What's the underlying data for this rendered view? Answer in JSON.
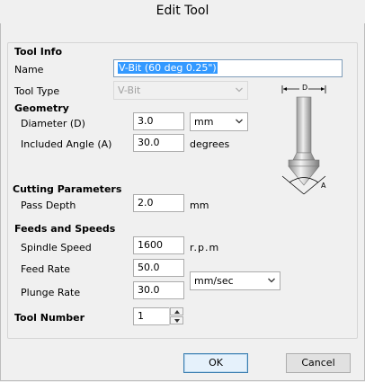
{
  "window": {
    "title": "Edit Tool"
  },
  "sections": {
    "tool_info": "Tool Info",
    "geometry": "Geometry",
    "cutting_parameters": "Cutting Parameters",
    "feeds_and_speeds": "Feeds and Speeds",
    "tool_number": "Tool Number"
  },
  "fields": {
    "name": {
      "label": "Name",
      "value": "V-Bit (60 deg 0.25\")"
    },
    "tool_type": {
      "label": "Tool Type",
      "value": "V-Bit"
    },
    "diameter": {
      "label": "Diameter (D)",
      "value": "3.0",
      "unit_selected": "mm"
    },
    "included_angle": {
      "label": "Included Angle (A)",
      "value": "30.0",
      "unit": "degrees"
    },
    "pass_depth": {
      "label": "Pass Depth",
      "value": "2.0",
      "unit": "mm"
    },
    "spindle_speed": {
      "label": "Spindle Speed",
      "value": "1600",
      "unit": "r.p.m"
    },
    "feed_rate": {
      "label": "Feed Rate",
      "value": "50.0"
    },
    "plunge_rate": {
      "label": "Plunge Rate",
      "value": "30.0"
    },
    "rate_unit_selected": "mm/sec",
    "tool_number": {
      "value": "1"
    }
  },
  "diagram": {
    "d_label": "D",
    "a_label": "A"
  },
  "buttons": {
    "ok": "OK",
    "cancel": "Cancel"
  }
}
